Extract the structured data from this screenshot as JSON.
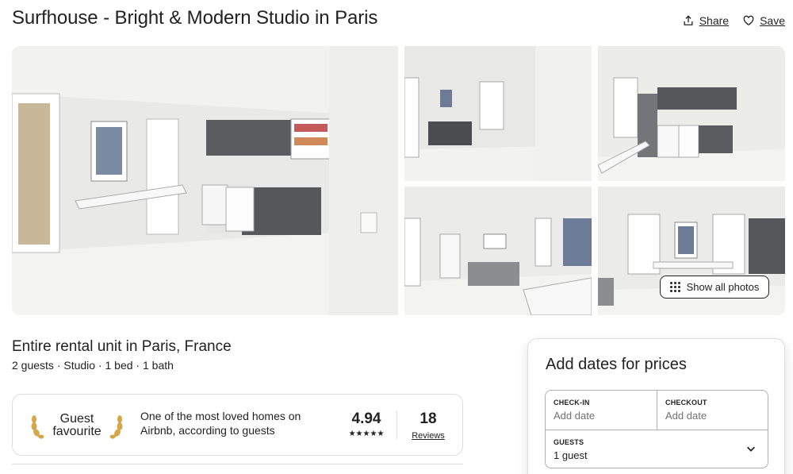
{
  "listing": {
    "title": "Surfhouse - Bright & Modern Studio in Paris",
    "subtitle": "Entire rental unit in Paris, France",
    "details": "2 guests · Studio · 1 bed · 1 bath"
  },
  "header_actions": {
    "share_label": "Share",
    "save_label": "Save"
  },
  "gallery": {
    "show_all_label": "Show all photos",
    "photos": [
      "kitchen-main",
      "living-room-sofa",
      "kitchen-wide",
      "living-room",
      "dining-window"
    ]
  },
  "guest_favourite": {
    "badge_line1": "Guest",
    "badge_line2": "favourite",
    "description": "One of the most loved homes on Airbnb, according to guests",
    "rating": "4.94",
    "stars": "★★★★★",
    "reviews_count": "18",
    "reviews_label": "Reviews"
  },
  "booking": {
    "title": "Add dates for prices",
    "checkin_label": "CHECK-IN",
    "checkin_value": "Add date",
    "checkout_label": "CHECKOUT",
    "checkout_value": "Add date",
    "guests_label": "GUESTS",
    "guests_value": "1 guest"
  },
  "colors": {
    "text": "#222222",
    "muted": "#717171",
    "border": "#dddddd"
  }
}
